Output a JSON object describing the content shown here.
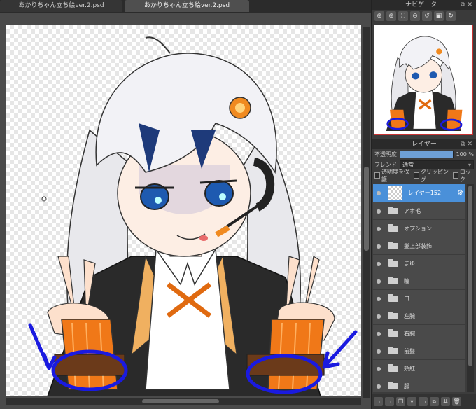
{
  "tabs": [
    {
      "label": "あかりちゃん立ち絵ver.2.psd"
    },
    {
      "label": "あかりちゃん立ち絵ver.2.psd"
    }
  ],
  "navigator": {
    "title": "ナビゲーター",
    "tools": [
      "zoom-in-icon",
      "zoom-in-icon",
      "fit-icon",
      "zoom-out-icon",
      "rotate-left-icon",
      "actual-size-icon",
      "rotate-right-icon"
    ]
  },
  "layers_panel": {
    "title": "レイヤー",
    "opacity_label": "不透明度",
    "opacity_value": "100 %",
    "opacity_fraction": 1.0,
    "blend_label": "ブレンド",
    "blend_value": "通常",
    "checks": {
      "protect_alpha": "透明度を保護",
      "clipping": "クリッピング",
      "lock": "ロック"
    },
    "layers": [
      {
        "name": "レイヤー152",
        "type": "raster",
        "selected": true
      },
      {
        "name": "アホ毛",
        "type": "folder"
      },
      {
        "name": "オプション",
        "type": "folder"
      },
      {
        "name": "髪上部装飾",
        "type": "folder"
      },
      {
        "name": "まゆ",
        "type": "folder"
      },
      {
        "name": "瞳",
        "type": "folder"
      },
      {
        "name": "口",
        "type": "folder"
      },
      {
        "name": "左腕",
        "type": "folder"
      },
      {
        "name": "右腕",
        "type": "folder"
      },
      {
        "name": "前髪",
        "type": "folder"
      },
      {
        "name": "頬紅",
        "type": "folder"
      },
      {
        "name": "服",
        "type": "folder"
      }
    ]
  },
  "colors": {
    "accent": "#4a90d9",
    "nav_border": "#c83232",
    "annotation": "#1a1ae0"
  }
}
